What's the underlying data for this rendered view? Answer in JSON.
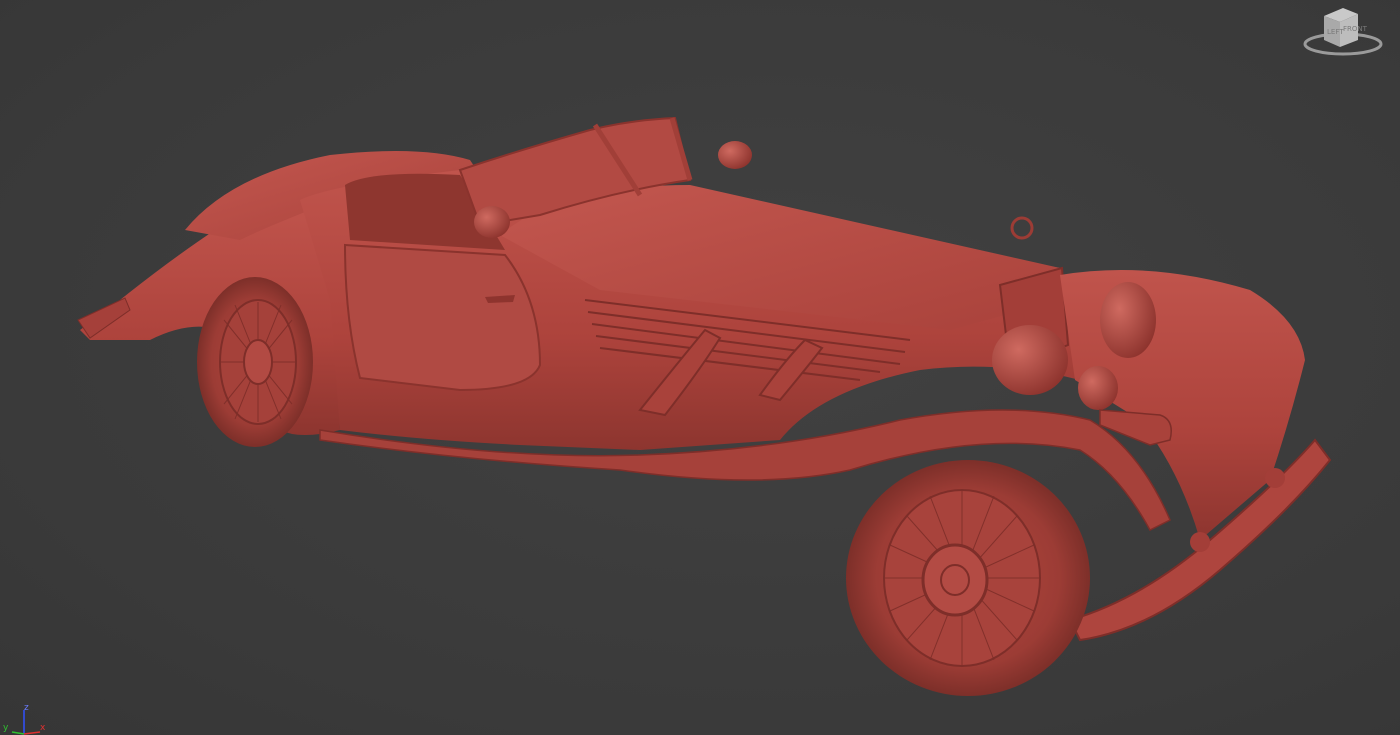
{
  "viewport": {
    "background_color": "#3c3c3c",
    "model_color": "#b3463f",
    "model_shadow_color": "#7e2e29",
    "model_highlight_color": "#c65a52"
  },
  "viewcube": {
    "face_front": "FRONT",
    "face_left": "LEFT",
    "icon": "viewcube-icon"
  },
  "axis_tripod": {
    "x_label": "x",
    "y_label": "y",
    "z_label": "z",
    "x_color": "#e03030",
    "y_color": "#30c030",
    "z_color": "#3050ff"
  }
}
